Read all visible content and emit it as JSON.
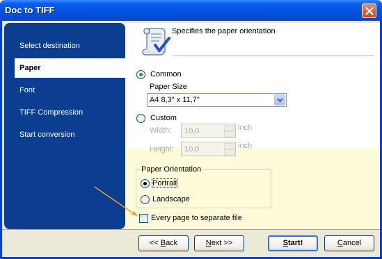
{
  "window": {
    "title": "Doc to TIFF"
  },
  "sidebar": {
    "items": [
      {
        "label": "Select destination",
        "selected": false
      },
      {
        "label": "Paper",
        "selected": true
      },
      {
        "label": "Font",
        "selected": false
      },
      {
        "label": "TIFF Compression",
        "selected": false
      },
      {
        "label": "Start conversion",
        "selected": false
      }
    ]
  },
  "header": {
    "description": "Specifies the paper orientation"
  },
  "paper": {
    "common_label": "Common",
    "common_selected": true,
    "paper_size_label": "Paper Size",
    "paper_size_value": "A4 8,3\" x 11,7\"",
    "custom_label": "Custom",
    "custom_selected": false,
    "width_label": "Width:",
    "width_value": "10,0",
    "height_label": "Height:",
    "height_value": "10,0",
    "unit": "inch"
  },
  "orientation": {
    "group_title": "Paper Orientation",
    "portrait_label": "Portrait",
    "portrait_selected": true,
    "landscape_label": "Landscape",
    "landscape_selected": false
  },
  "separate_file": {
    "label": "Every page to separate file",
    "checked": false
  },
  "buttons": {
    "back_prefix": "<< ",
    "back_underlined": "B",
    "back_rest": "ack",
    "next_underlined": "N",
    "next_rest": "ext >>",
    "start_underlined": "S",
    "start_rest": "tart!",
    "cancel_underlined": "C",
    "cancel_rest": "ancel"
  },
  "colors": {
    "sidebar_bg": "#0b3d91",
    "accent_arrow": "#f0a030",
    "radio_selected": "#21a121"
  }
}
